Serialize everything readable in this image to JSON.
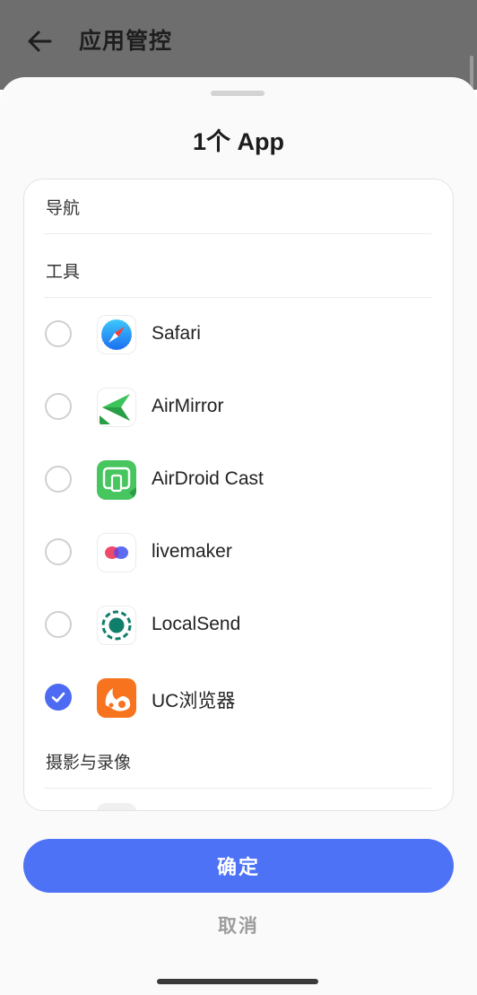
{
  "header": {
    "title": "应用管控",
    "back_icon": "arrow-left-icon"
  },
  "sheet": {
    "title": "1个 App",
    "sections": [
      {
        "label": "导航"
      },
      {
        "label": "工具"
      },
      {
        "label": "摄影与录像"
      }
    ],
    "apps": [
      {
        "name": "Safari",
        "icon": "safari-icon",
        "checked": false
      },
      {
        "name": "AirMirror",
        "icon": "airmirror-icon",
        "checked": false
      },
      {
        "name": "AirDroid Cast",
        "icon": "airdroid-cast-icon",
        "checked": false
      },
      {
        "name": "livemaker",
        "icon": "livemaker-icon",
        "checked": false
      },
      {
        "name": "LocalSend",
        "icon": "localsend-icon",
        "checked": false
      },
      {
        "name": "UC浏览器",
        "icon": "uc-browser-icon",
        "checked": true
      }
    ]
  },
  "actions": {
    "confirm_label": "确定",
    "cancel_label": "取消"
  },
  "colors": {
    "accent": "#4d72f5",
    "check": "#4d6bf2"
  }
}
